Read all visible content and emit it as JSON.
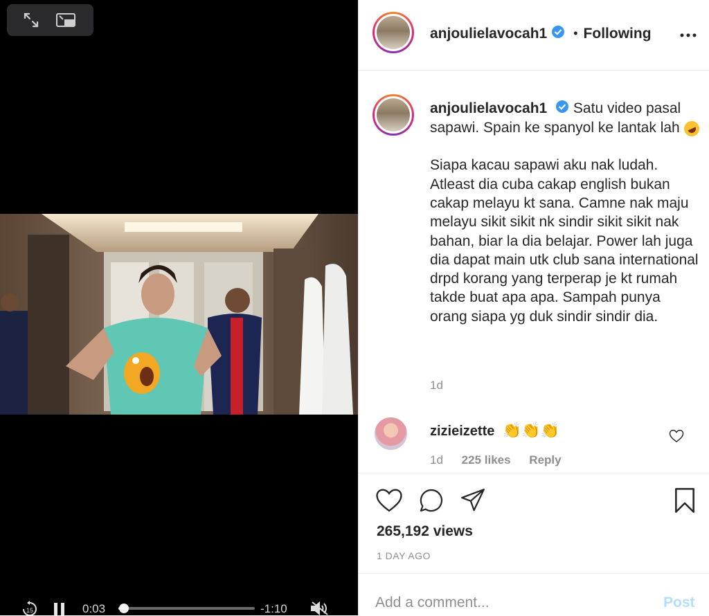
{
  "player": {
    "skip_seconds": "15",
    "elapsed": "0:03",
    "remaining": "-1:10",
    "progress": 0.04
  },
  "post": {
    "username": "anjoulielavocah1",
    "follow_state": "Following",
    "separator": "•"
  },
  "caption": {
    "username": "anjoulielavocah1",
    "first_line": "Satu video pasal sapawi. Spain ke spanyol ke lantak lah",
    "body": "Siapa kacau sapawi aku nak ludah. Atleast dia cuba cakap english bukan cakap melayu kt sana. Camne nak maju melayu sikit sikit nk sindir sikit sikit nak bahan, biar la dia belajar. Power lah juga dia dapat main utk club sana international drpd korang yang terperap je kt rumah takde buat apa apa. Sampah punya orang siapa yg duk sindir sindir dia.",
    "time": "1d"
  },
  "comment": {
    "username": "zizieizette",
    "claps": "👏👏👏",
    "time": "1d",
    "likes": "225 likes",
    "reply": "Reply"
  },
  "stats": {
    "views": "265,192 views",
    "posted": "1 DAY AGO"
  },
  "composer": {
    "placeholder": "Add a comment...",
    "post_label": "Post"
  },
  "colors": {
    "video_bg": "#000000",
    "verified": "#3897f0",
    "post_button": "#b2dffc",
    "muted_text": "#8e8e8e"
  },
  "icons": [
    "expand-icon",
    "pip-icon",
    "skip-back-15-icon",
    "pause-icon",
    "mute-icon",
    "verified-badge-icon",
    "more-options-icon",
    "heart-icon",
    "comment-icon",
    "share-icon",
    "bookmark-icon",
    "rofl-emoji-icon",
    "clap-emoji-icon"
  ]
}
